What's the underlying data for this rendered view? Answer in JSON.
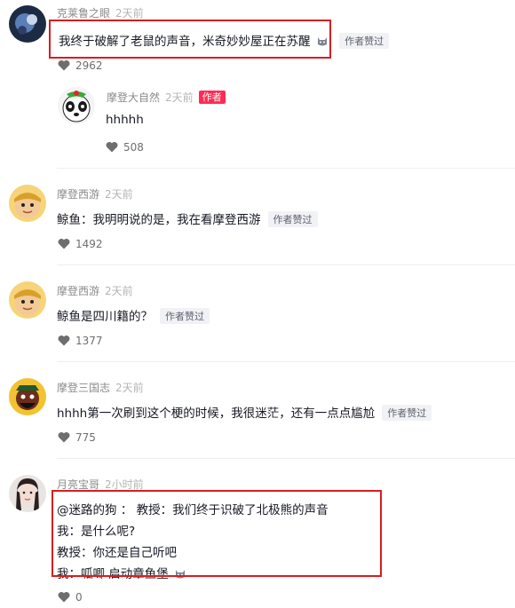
{
  "comments": [
    {
      "username": "克莱鲁之眼",
      "time": "2天前",
      "text": "我终于破解了老鼠的声音，米奇妙妙屋正在苏醒",
      "badge": "作者赞过",
      "likes": "2962",
      "reply": {
        "username": "摩登大自然",
        "time": "2天前",
        "author_tag": "作者",
        "text": "hhhhh",
        "likes": "508"
      }
    },
    {
      "username": "摩登西游",
      "time": "2天前",
      "text": "鲸鱼：我明明说的是，我在看摩登西游",
      "badge": "作者赞过",
      "likes": "1492"
    },
    {
      "username": "摩登西游",
      "time": "2天前",
      "text": "鲸鱼是四川籍的？",
      "badge": "作者赞过",
      "likes": "1377"
    },
    {
      "username": "摩登三国志",
      "time": "2天前",
      "text": "hhhh第一次刷到这个梗的时候，我很迷茫，还有一点点尴尬",
      "badge": "作者赞过",
      "likes": "775"
    },
    {
      "username": "月亮宝哥",
      "time": "2小时前",
      "lines": [
        "@迷路的狗 ： 教授：我们终于识破了北极熊的声音",
        "我：是什么呢?",
        "教授：你还是自己听吧",
        "我：呱唧 启动章鱼堡"
      ],
      "likes": "0"
    }
  ],
  "colors": {
    "highlight": "#d81e1e",
    "author_tag": "#fe2c55"
  },
  "icons": [
    "heart-icon",
    "cat-emoji-icon",
    "avatar-image"
  ]
}
